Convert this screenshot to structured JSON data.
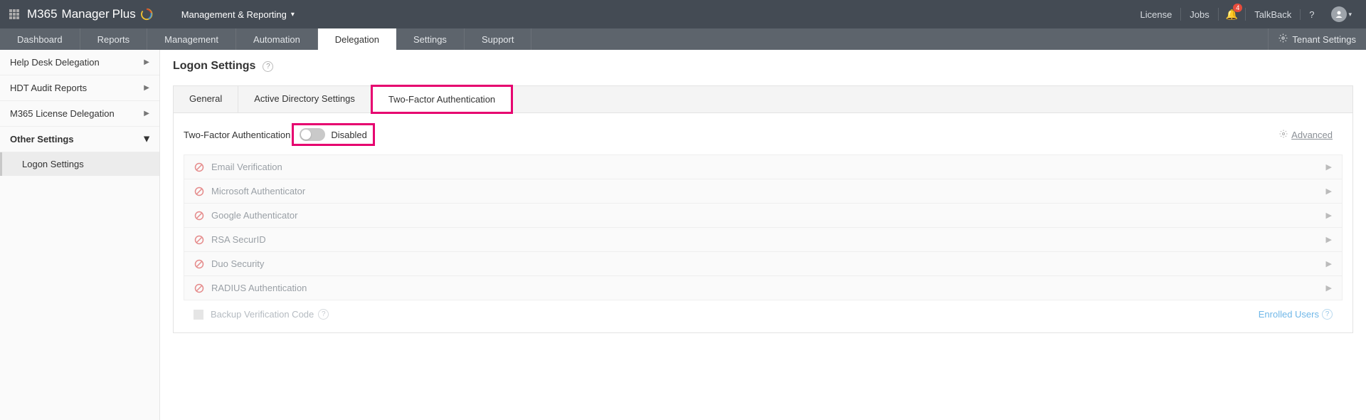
{
  "header": {
    "brand_1": "M365",
    "brand_2": "Manager",
    "brand_3": "Plus",
    "section_dropdown": "Management & Reporting",
    "links": {
      "license": "License",
      "jobs": "Jobs",
      "talkback": "TalkBack"
    },
    "notification_count": "4",
    "help": "?",
    "tenant_settings": "Tenant Settings"
  },
  "nav": {
    "items": [
      "Dashboard",
      "Reports",
      "Management",
      "Automation",
      "Delegation",
      "Settings",
      "Support"
    ],
    "active_index": 4
  },
  "sidebar": {
    "items": [
      {
        "label": "Help Desk Delegation",
        "expanded": false
      },
      {
        "label": "HDT Audit Reports",
        "expanded": false
      },
      {
        "label": "M365 License Delegation",
        "expanded": false
      },
      {
        "label": "Other Settings",
        "expanded": true
      }
    ],
    "sub_item": "Logon Settings"
  },
  "page": {
    "title": "Logon Settings",
    "tabs": [
      "General",
      "Active Directory Settings",
      "Two-Factor Authentication"
    ],
    "tfa_label": "Two-Factor Authentication",
    "toggle_state": "Disabled",
    "advanced": "Advanced",
    "methods": [
      "Email Verification",
      "Microsoft Authenticator",
      "Google Authenticator",
      "RSA SecurID",
      "Duo Security",
      "RADIUS Authentication"
    ],
    "backup_label": "Backup Verification Code",
    "enrolled_users": "Enrolled Users"
  }
}
